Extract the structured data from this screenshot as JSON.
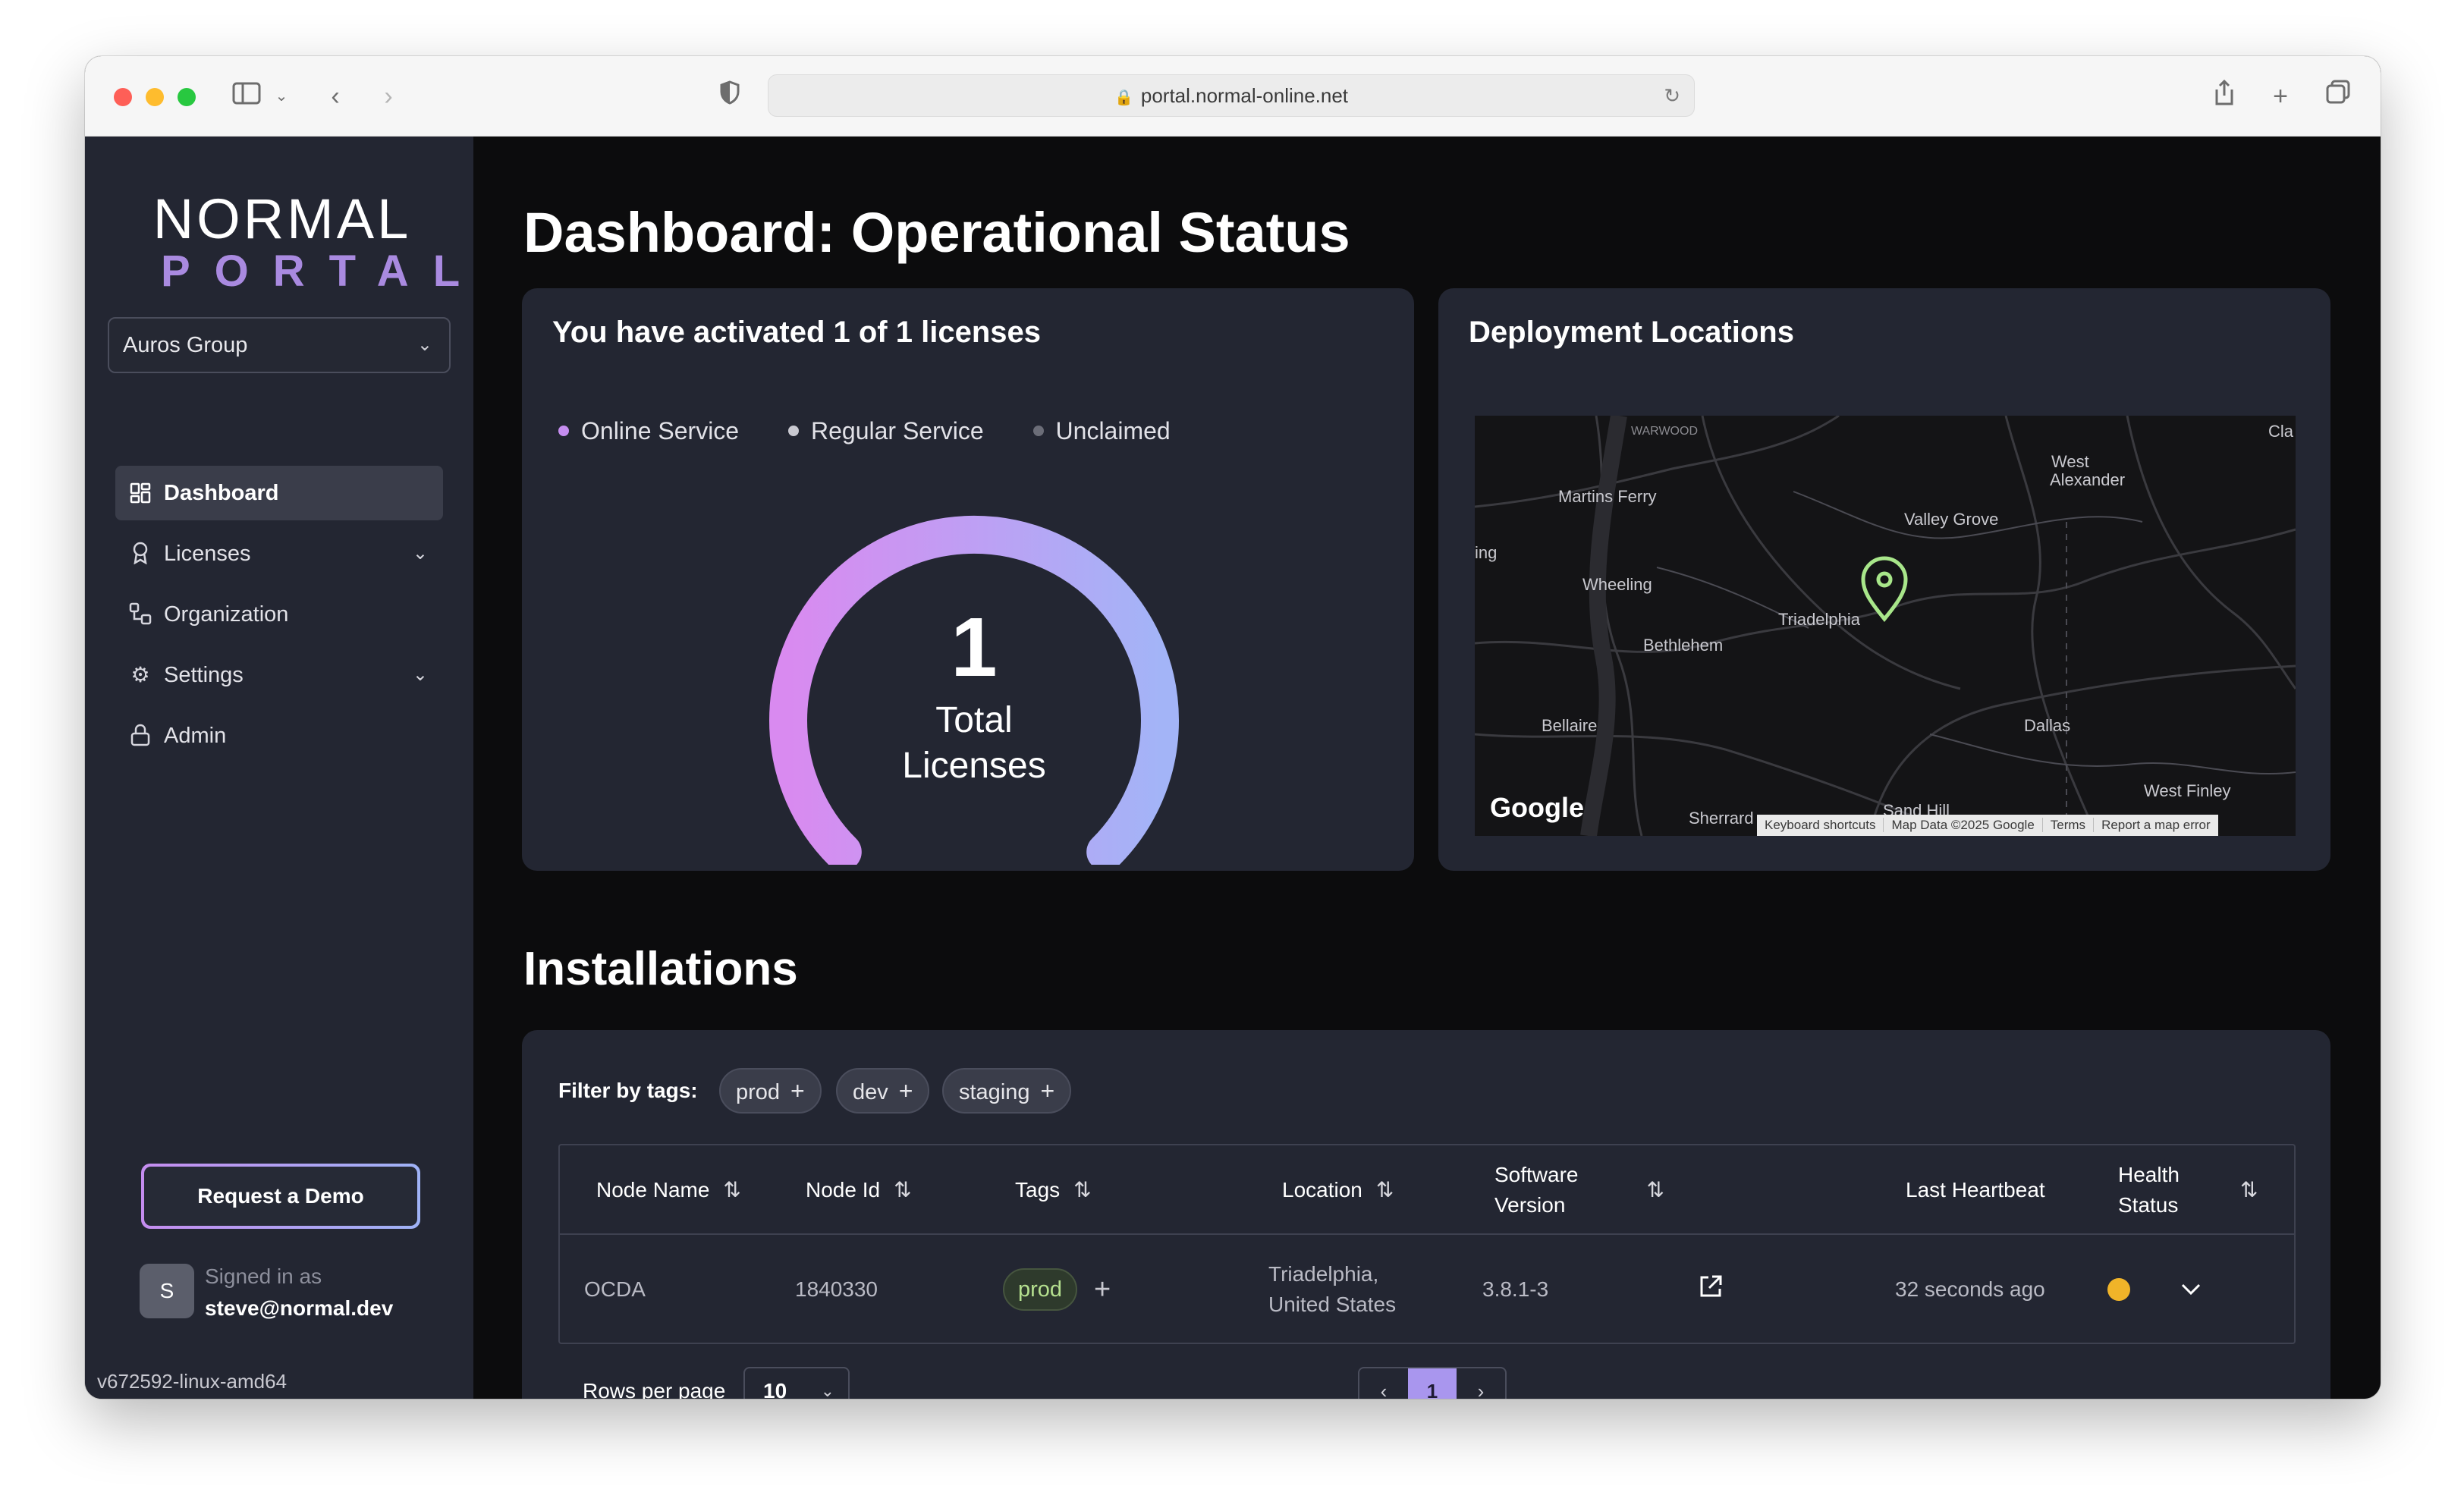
{
  "browser": {
    "url": "portal.normal-online.net"
  },
  "sidebar": {
    "logo_line1": "NORMAL",
    "logo_line2": "PORTAL",
    "org_selected": "Auros Group",
    "items": [
      {
        "label": "Dashboard",
        "icon": "dashboard-grid-icon",
        "active": true
      },
      {
        "label": "Licenses",
        "icon": "award-icon",
        "expandable": true
      },
      {
        "label": "Organization",
        "icon": "organization-icon"
      },
      {
        "label": "Settings",
        "icon": "gear-icon",
        "expandable": true
      },
      {
        "label": "Admin",
        "icon": "lock-icon"
      }
    ],
    "demo_button": "Request a Demo",
    "signed_in_label": "Signed in as",
    "avatar_initial": "S",
    "user_email": "steve@normal.dev",
    "version": "v672592-linux-amd64"
  },
  "main": {
    "title": "Dashboard: Operational Status",
    "licenses_card": {
      "title": "You have activated 1 of 1 licenses",
      "legend": [
        {
          "label": "Online Service",
          "color": "#c58df0"
        },
        {
          "label": "Regular Service",
          "color": "#c9c9d1"
        },
        {
          "label": "Unclaimed",
          "color": "#6b6d78"
        }
      ],
      "total_value": "1",
      "total_label_line1": "Total",
      "total_label_line2": "Licenses",
      "gauge_fraction": 1.0,
      "gauge_colors": [
        "#d98af0",
        "#a3b4f7"
      ]
    },
    "map_card": {
      "title": "Deployment Locations",
      "towns": [
        "WARWOOD",
        "Cla",
        "West",
        "Alexander",
        "Martins Ferry",
        "Valley Grove",
        "ing",
        "Wheeling",
        "Triadelphia",
        "Bethlehem",
        "Bellaire",
        "Dallas",
        "West Finley",
        "Sand Hill",
        "Sherrard"
      ],
      "google_label": "Google",
      "attribution": [
        "Keyboard shortcuts",
        "Map Data ©2025 Google",
        "Terms",
        "Report a map error"
      ],
      "marker_color": "#a8e68a"
    },
    "installations": {
      "title": "Installations",
      "filter_label": "Filter by tags:",
      "filter_tags": [
        "prod",
        "dev",
        "staging"
      ],
      "columns": {
        "node_name": "Node Name",
        "node_id": "Node Id",
        "tags": "Tags",
        "location": "Location",
        "software_line1": "Software",
        "software_line2": "Version",
        "last_heartbeat": "Last Heartbeat",
        "health_line1": "Health",
        "health_line2": "Status"
      },
      "rows": [
        {
          "node_name": "OCDA",
          "node_id": "1840330",
          "tag": "prod",
          "location_line1": "Triadelphia,",
          "location_line2": "United States",
          "software_version": "3.8.1-3",
          "last_heartbeat": "32 seconds ago",
          "health_color": "#f0b429"
        }
      ],
      "rows_per_page_label": "Rows per page",
      "rows_per_page": "10",
      "current_page": "1"
    }
  }
}
